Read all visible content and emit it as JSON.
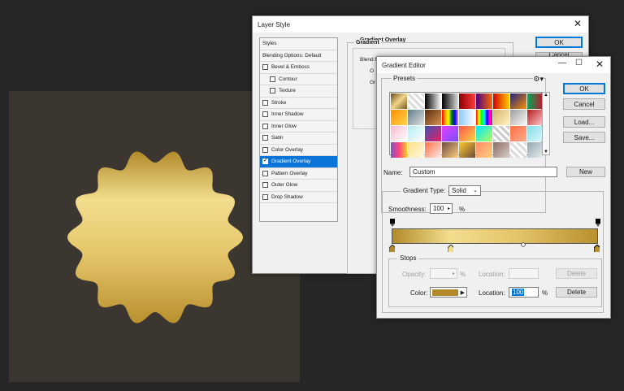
{
  "layer_style": {
    "title": "Layer Style",
    "styles_header": "Styles",
    "items": [
      {
        "label": "Blending Options: Default",
        "checkbox": false,
        "checked": false,
        "indent": false,
        "selected": false
      },
      {
        "label": "Bevel & Emboss",
        "checkbox": true,
        "checked": false,
        "indent": false,
        "selected": false
      },
      {
        "label": "Contour",
        "checkbox": true,
        "checked": false,
        "indent": true,
        "selected": false
      },
      {
        "label": "Texture",
        "checkbox": true,
        "checked": false,
        "indent": true,
        "selected": false
      },
      {
        "label": "Stroke",
        "checkbox": true,
        "checked": false,
        "indent": false,
        "selected": false
      },
      {
        "label": "Inner Shadow",
        "checkbox": true,
        "checked": false,
        "indent": false,
        "selected": false
      },
      {
        "label": "Inner Glow",
        "checkbox": true,
        "checked": false,
        "indent": false,
        "selected": false
      },
      {
        "label": "Satin",
        "checkbox": true,
        "checked": false,
        "indent": false,
        "selected": false
      },
      {
        "label": "Color Overlay",
        "checkbox": true,
        "checked": false,
        "indent": false,
        "selected": false
      },
      {
        "label": "Gradient Overlay",
        "checkbox": true,
        "checked": true,
        "indent": false,
        "selected": true
      },
      {
        "label": "Pattern Overlay",
        "checkbox": true,
        "checked": false,
        "indent": false,
        "selected": false
      },
      {
        "label": "Outer Glow",
        "checkbox": true,
        "checked": false,
        "indent": false,
        "selected": false
      },
      {
        "label": "Drop Shadow",
        "checkbox": true,
        "checked": false,
        "indent": false,
        "selected": false
      }
    ],
    "panel_title": "Gradient Overlay",
    "panel_sub": "Gradient",
    "blend_label": "Blend M",
    "o_label": "O",
    "g_label": "Gr",
    "ok": "OK",
    "cancel": "Cancel"
  },
  "gradient_editor": {
    "title": "Gradient Editor",
    "presets_label": "Presets",
    "ok": "OK",
    "cancel": "Cancel",
    "load": "Load...",
    "save": "Save...",
    "name_label": "Name:",
    "name_value": "Custom",
    "new_button": "New",
    "gradient_type_label": "Gradient Type:",
    "gradient_type_value": "Solid",
    "smoothness_label": "Smoothness:",
    "smoothness_value": "100",
    "smoothness_unit": "%",
    "stops_label": "Stops",
    "opacity_label": "Opacity:",
    "opacity_unit": "%",
    "location_label": "Location:",
    "delete_label": "Delete",
    "color_label": "Color:",
    "location_value": "100",
    "location_unit": "%",
    "color_stop_color": "#b28a2a"
  },
  "badge_colors": [
    "#b28a2a",
    "#f2dd8e",
    "#e5c56a",
    "#b9902e"
  ],
  "preset_swatches": [
    "linear-gradient(135deg,#6a4a1a,#f0d58a,#7a5520)",
    "repeating-linear-gradient(45deg,#ddd 0 3px,#fff 3px 6px)",
    "linear-gradient(90deg,#000,#fff)",
    "linear-gradient(90deg,#000,#ddd)",
    "linear-gradient(90deg,#8b0000,#ff3b3b)",
    "linear-gradient(90deg,#4b0082,#ff6a00)",
    "linear-gradient(90deg,#d40000,#ffcc00)",
    "linear-gradient(135deg,#1a237e,#ff8f00)",
    "linear-gradient(90deg,#00a651,#c8102e)",
    "linear-gradient(135deg,#ff8f00,#ffd54f)",
    "linear-gradient(135deg,#607d8b,#e0e0e0)",
    "linear-gradient(135deg,#5a2d0c,#d99355)",
    "linear-gradient(90deg,red,orange,yellow,green,blue,violet)",
    "linear-gradient(90deg,#90caf9,#fff)",
    "linear-gradient(90deg,red,yellow,lime,cyan,blue,magenta,red)",
    "linear-gradient(135deg,#d7b56d,#fff3c4)",
    "linear-gradient(135deg,#9e9e9e,#fafafa)",
    "linear-gradient(135deg,#b71c1c,#ffcdd2)",
    "linear-gradient(135deg,#f8bbd0,#fff)",
    "linear-gradient(135deg,#b2ebf2,#fff)",
    "linear-gradient(135deg,#3f51b5,#e91e63)",
    "linear-gradient(135deg,#e040fb,#7c4dff)",
    "linear-gradient(135deg,#ff5252,#ffd740)",
    "linear-gradient(135deg,#00e5ff,#b2ff59)",
    "repeating-linear-gradient(45deg,#ccc 0 3px,#fff 3px 6px)",
    "linear-gradient(135deg,#ff6e40,#ffab91)",
    "linear-gradient(135deg,#80deea,#e0f7fa)",
    "linear-gradient(90deg,#7e57c2,#ff4081,#ffca28)",
    "linear-gradient(135deg,#ffe082,#fff8e1)",
    "linear-gradient(135deg,#ff7043,#fbe9e7)",
    "linear-gradient(135deg,#6d4c41,#ffcc80)",
    "linear-gradient(135deg,#ffca28,#6d4c41)",
    "linear-gradient(135deg,#ff8a65,#ffd180)",
    "linear-gradient(135deg,#8d6e63,#d7ccc8)",
    "repeating-linear-gradient(45deg,#ddd 0 3px,#fff 3px 6px)",
    "linear-gradient(135deg,#90a4ae,#eceff1)"
  ]
}
